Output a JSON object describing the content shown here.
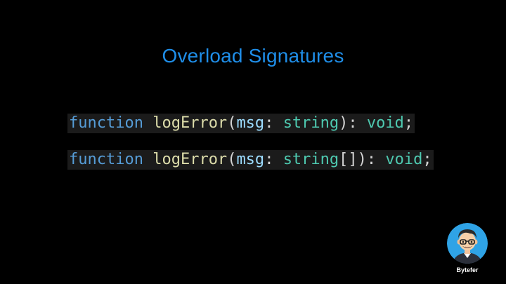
{
  "slide": {
    "title": "Overload Signatures"
  },
  "code": {
    "line1": {
      "keyword": "function",
      "name": "logError",
      "open_paren": "(",
      "param": "msg",
      "colon1": ": ",
      "type": "string",
      "close": "): ",
      "return_type": "void",
      "end": ";"
    },
    "line2": {
      "keyword": "function",
      "name": "logError",
      "open_paren": "(",
      "param": "msg",
      "colon1": ": ",
      "type": "string",
      "close": "[]): ",
      "return_type": "void",
      "end": ";"
    }
  },
  "branding": {
    "name": "Bytefer",
    "avatar_icon": "cartoon-avatar-icon"
  },
  "colors": {
    "background": "#000000",
    "title": "#1f8ee8",
    "keyword": "#569cd6",
    "function_name": "#dcdcaa",
    "punctuation": "#d4d4d4",
    "identifier": "#9cdcfe",
    "type": "#4ec9b0",
    "avatar_bg": "#2fa3e6"
  }
}
